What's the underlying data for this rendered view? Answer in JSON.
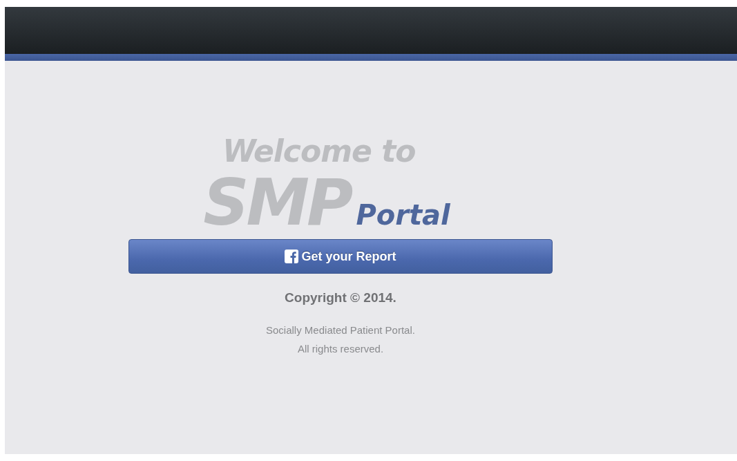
{
  "logo": {
    "welcome": "Welcome to",
    "brand": "SMP",
    "suffix": "Portal"
  },
  "button": {
    "label": "Get your Report"
  },
  "footer": {
    "copyright": "Copyright © 2014.",
    "lines": [
      "Socially Mediated Patient Portal.",
      "All rights reserved."
    ]
  }
}
